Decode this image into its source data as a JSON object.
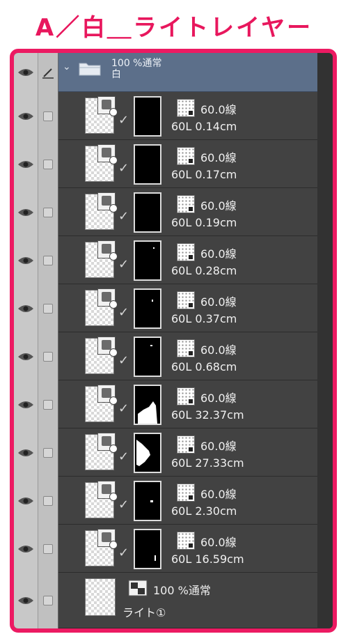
{
  "title": "A／白＿ライトレイヤー",
  "folder": {
    "opacity_blend": "100 %通常",
    "name": "白",
    "icons": {
      "visibility": "eye-icon",
      "edit": "pen-icon",
      "expand": "chevron-down-icon",
      "type": "folder-icon"
    }
  },
  "layers": [
    {
      "tone": "60.0線",
      "name": "60L 0.14cm"
    },
    {
      "tone": "60.0線",
      "name": "60L 0.17cm"
    },
    {
      "tone": "60.0線",
      "name": "60L 0.19cm"
    },
    {
      "tone": "60.0線",
      "name": "60L 0.28cm"
    },
    {
      "tone": "60.0線",
      "name": "60L 0.37cm"
    },
    {
      "tone": "60.0線",
      "name": "60L 0.68cm"
    },
    {
      "tone": "60.0線",
      "name": "60L 32.37cm"
    },
    {
      "tone": "60.0線",
      "name": "60L 27.33cm"
    },
    {
      "tone": "60.0線",
      "name": "60L 2.30cm"
    },
    {
      "tone": "60.0線",
      "name": "60L 16.59cm"
    }
  ],
  "base_layer": {
    "opacity_blend": "100 %通常",
    "name": "ライト①"
  },
  "colors": {
    "accent": "#ec1a62",
    "folder_row": "#5c6f8a",
    "layer_row": "#424242"
  }
}
